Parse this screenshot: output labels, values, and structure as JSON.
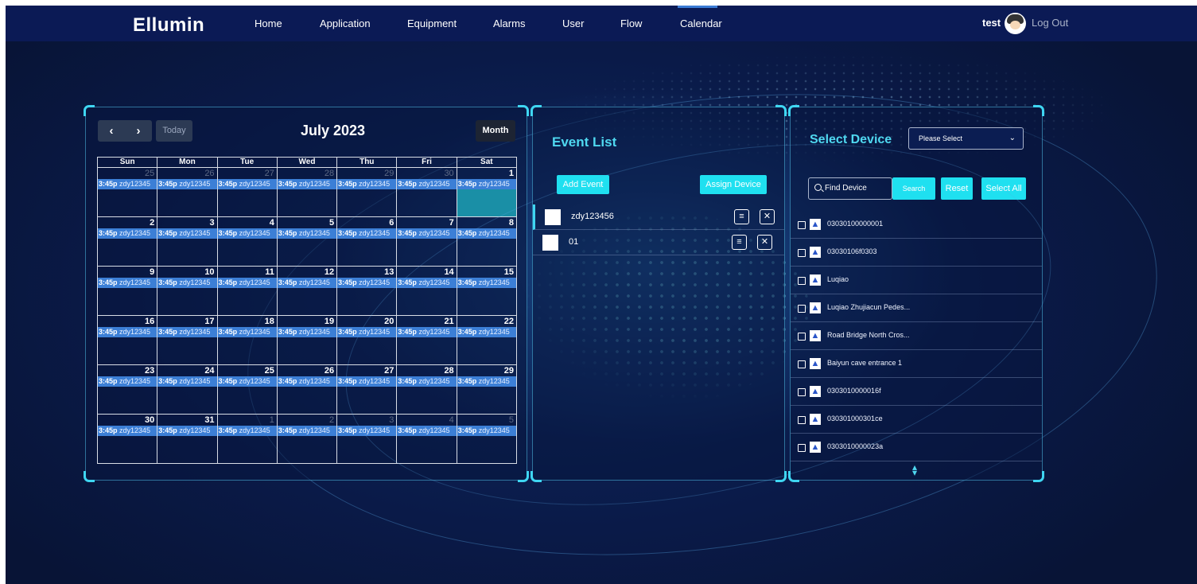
{
  "app": {
    "logo": "Ellumin"
  },
  "nav": {
    "items": [
      "Home",
      "Application",
      "Equipment",
      "Alarms",
      "User",
      "Flow",
      "Calendar"
    ],
    "active": "Calendar"
  },
  "user": {
    "name": "test",
    "logout": "Log Out"
  },
  "calendar": {
    "prev": "‹",
    "next": "›",
    "today_label": "Today",
    "title": "July 2023",
    "view_label": "Month",
    "weekdays": [
      "Sun",
      "Mon",
      "Tue",
      "Wed",
      "Thu",
      "Fri",
      "Sat"
    ],
    "event_time": "3:45p",
    "event_name": "zdy12345",
    "weeks": [
      [
        [
          "25",
          1
        ],
        [
          "26",
          1
        ],
        [
          "27",
          1
        ],
        [
          "28",
          1
        ],
        [
          "29",
          1
        ],
        [
          "30",
          1
        ],
        [
          "1",
          0
        ]
      ],
      [
        [
          "2",
          0
        ],
        [
          "3",
          0
        ],
        [
          "4",
          0
        ],
        [
          "5",
          0
        ],
        [
          "6",
          0
        ],
        [
          "7",
          0
        ],
        [
          "8",
          0
        ]
      ],
      [
        [
          "9",
          0
        ],
        [
          "10",
          0
        ],
        [
          "11",
          0
        ],
        [
          "12",
          0
        ],
        [
          "13",
          0
        ],
        [
          "14",
          0
        ],
        [
          "15",
          0
        ]
      ],
      [
        [
          "16",
          0
        ],
        [
          "17",
          0
        ],
        [
          "18",
          0
        ],
        [
          "19",
          0
        ],
        [
          "20",
          0
        ],
        [
          "21",
          0
        ],
        [
          "22",
          0
        ]
      ],
      [
        [
          "23",
          0
        ],
        [
          "24",
          0
        ],
        [
          "25",
          0
        ],
        [
          "26",
          0
        ],
        [
          "27",
          0
        ],
        [
          "28",
          0
        ],
        [
          "29",
          0
        ]
      ],
      [
        [
          "30",
          0
        ],
        [
          "31",
          0
        ],
        [
          "1",
          1
        ],
        [
          "2",
          1
        ],
        [
          "3",
          1
        ],
        [
          "4",
          1
        ],
        [
          "5",
          1
        ]
      ]
    ],
    "selected_date": "1"
  },
  "event_list": {
    "title": "Event List",
    "add_label": "Add Event",
    "assign_label": "Assign Device",
    "events": [
      {
        "name": "zdy123456"
      },
      {
        "name": "01"
      }
    ],
    "colors": {
      "accent": "#1fe0f0"
    }
  },
  "device": {
    "title": "Select Device",
    "select_placeholder": "Please Select",
    "find_placeholder": "Find Device",
    "search_label": "Search",
    "reset_label": "Reset",
    "select_all_label": "Select All",
    "devices": [
      "03030100000001",
      "03030106f0303",
      "Luqiao",
      "Luqiao Zhujiacun Pedes...",
      "Road Bridge North Cros...",
      "Baiyun cave entrance 1",
      "0303010000016f",
      "030301000301ce",
      "0303010000023a"
    ]
  }
}
